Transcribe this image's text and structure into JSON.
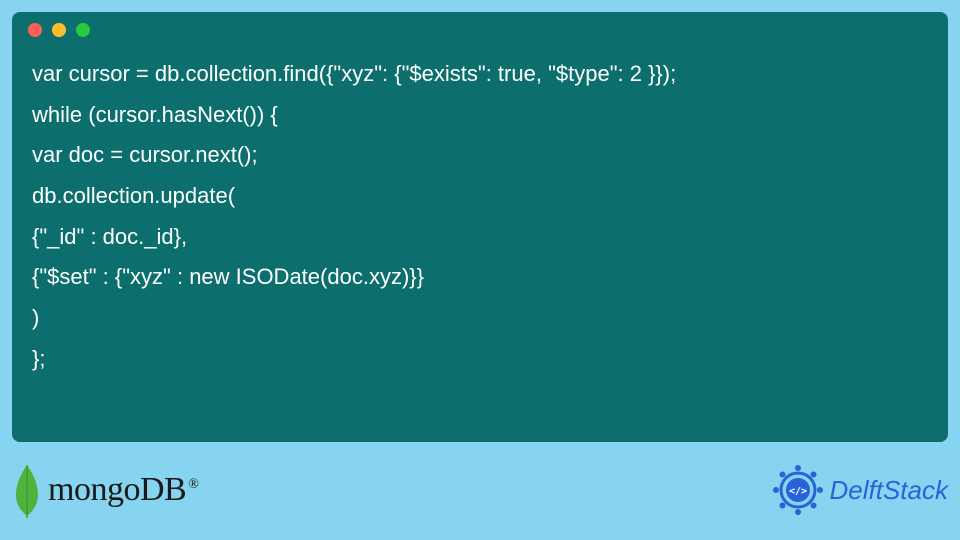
{
  "code": {
    "lines": [
      "var cursor = db.collection.find({\"xyz\": {\"$exists\": true, \"$type\": 2 }});",
      "while (cursor.hasNext()) {",
      "var doc = cursor.next();",
      "db.collection.update(",
      "{\"_id\" : doc._id},",
      "{\"$set\" : {\"xyz\" : new ISODate(doc.xyz)}}",
      ")",
      "};"
    ]
  },
  "logos": {
    "mongodb": "mongoDB",
    "delftstack": "DelftStack"
  }
}
